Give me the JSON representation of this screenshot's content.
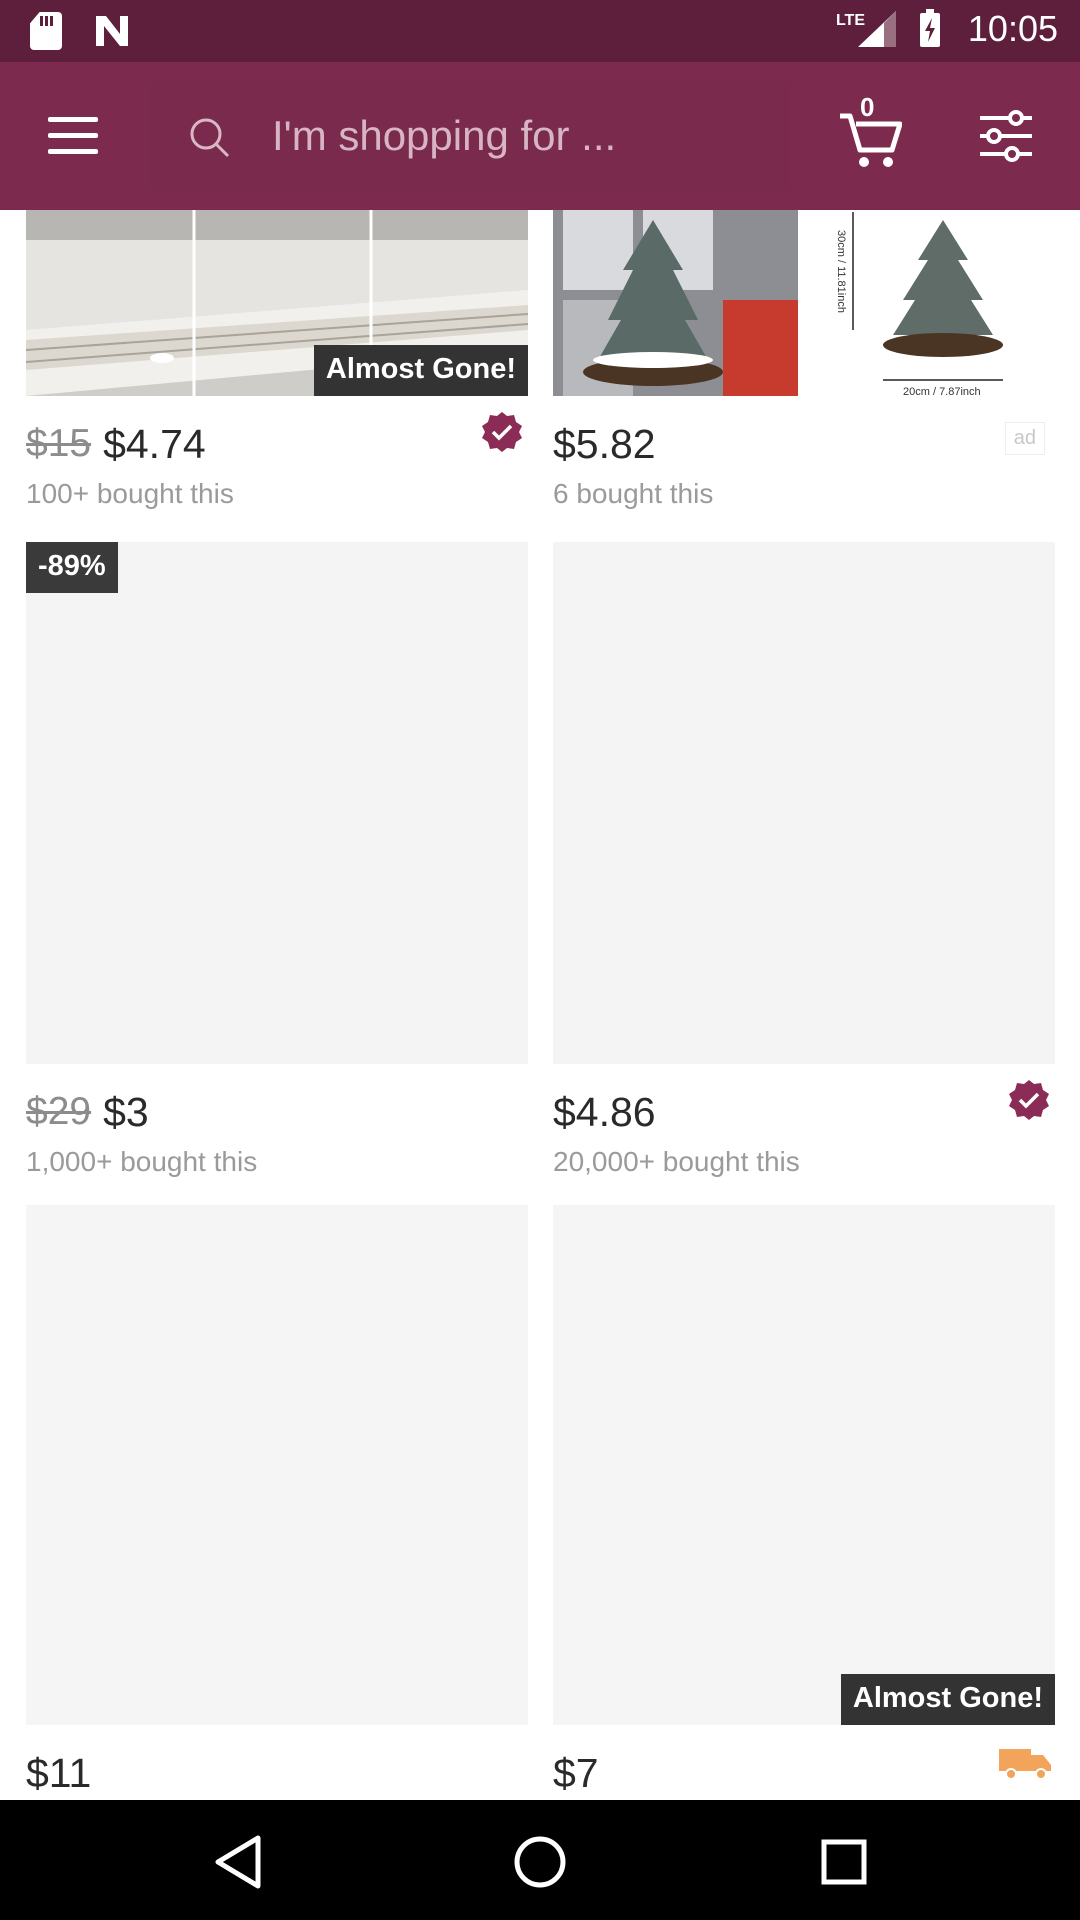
{
  "status_bar": {
    "network": "LTE",
    "time": "10:05"
  },
  "header": {
    "search_placeholder": "I'm shopping for ...",
    "cart_count": "0",
    "accent_color": "#7d2a4f"
  },
  "products": [
    {
      "old_price": "$15",
      "price": "$4.74",
      "bought": "100+ bought this",
      "badge": "Almost Gone!",
      "verified": true
    },
    {
      "price": "$5.82",
      "bought": "6 bought this",
      "ad": "ad",
      "image_labels": [
        "30cm / 11.81inch",
        "20cm / 7.87inch"
      ]
    },
    {
      "discount": "-89%",
      "old_price": "$29",
      "price": "$3",
      "bought": "1,000+ bought this"
    },
    {
      "price": "$4.86",
      "bought": "20,000+ bought this",
      "verified": true
    },
    {
      "price": "$11"
    },
    {
      "price": "$7",
      "badge": "Almost Gone!"
    }
  ]
}
